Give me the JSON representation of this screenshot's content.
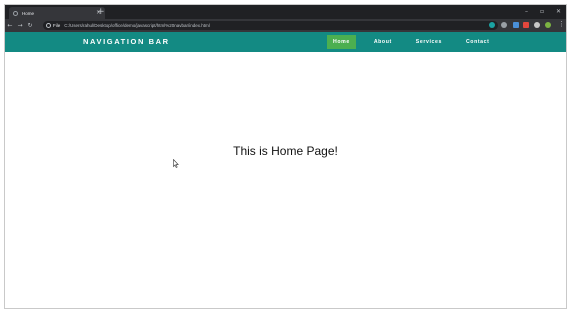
{
  "browser": {
    "tab_title": "Home",
    "new_tab_symbol": "+",
    "tab_close_symbol": "×",
    "url_scheme": "File",
    "url_path": "C:/Users/rahul/Desktop/office/demo/javascript/html%20navbar/index.html",
    "icons": [
      "back-icon",
      "forward-icon",
      "reload-icon",
      "info-icon",
      "star-icon",
      "extension-icons",
      "profile-avatar",
      "menu-icon"
    ]
  },
  "page": {
    "brand": "NAVIGATION BAR",
    "nav": [
      {
        "label": "Home",
        "active": true
      },
      {
        "label": "About",
        "active": false
      },
      {
        "label": "Services",
        "active": false
      },
      {
        "label": "Contact",
        "active": false
      }
    ],
    "heading": "This is Home Page!"
  },
  "colors": {
    "navbar_bg": "#138a83",
    "active_link_bg": "#4caf50",
    "browser_dark": "#202124",
    "browser_toolbar": "#35363a"
  }
}
